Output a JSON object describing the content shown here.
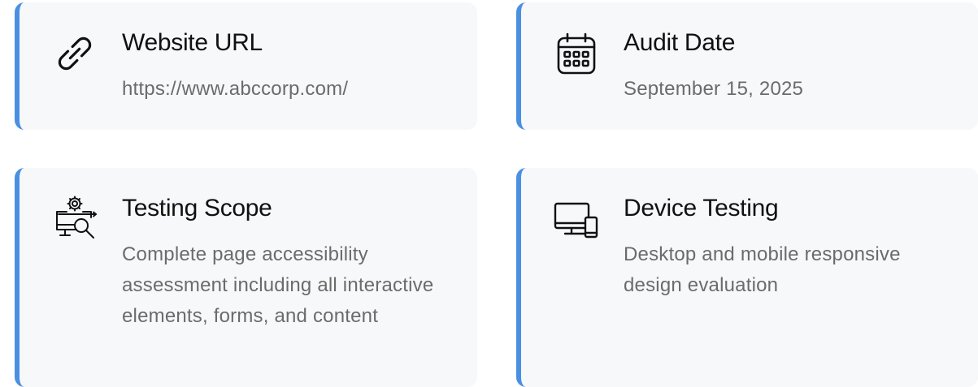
{
  "cards": [
    {
      "icon": "link-icon",
      "title": "Website URL",
      "value": "https://www.abccorp.com/"
    },
    {
      "icon": "calendar-icon",
      "title": "Audit Date",
      "value": "September 15, 2025"
    },
    {
      "icon": "monitor-search-gear-icon",
      "title": "Testing Scope",
      "value": "Complete page accessibility assessment including all interactive elements, forms, and content"
    },
    {
      "icon": "desktop-mobile-icon",
      "title": "Device Testing",
      "value": "Desktop and mobile responsive design evaluation"
    }
  ],
  "colors": {
    "accent": "#4a90e2",
    "card_background": "#f7f8fa",
    "title": "#111111",
    "text": "#6b6b6b"
  }
}
